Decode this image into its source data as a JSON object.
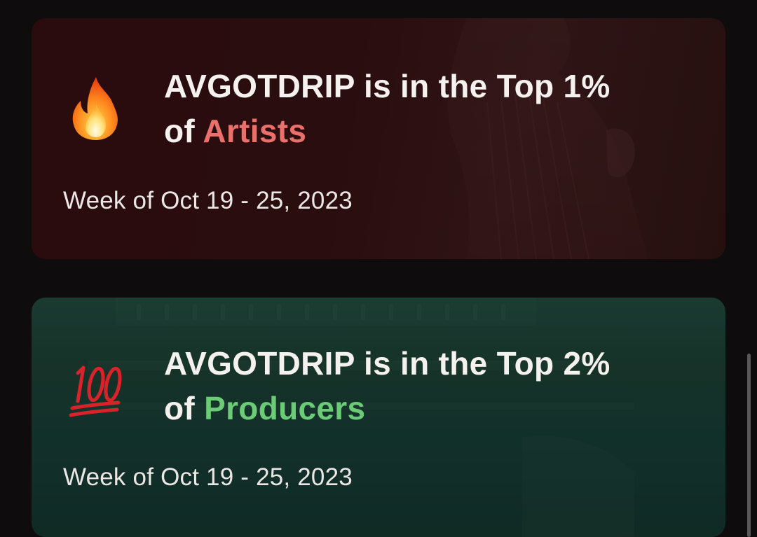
{
  "cards": [
    {
      "id": "artists",
      "icon": "fire-emoji-icon",
      "headline_prefix": "AVGOTDRIP is in the Top 1%",
      "headline_of": "of",
      "highlight": "Artists",
      "highlight_color": "#e9706b",
      "week": "Week of Oct 19 - 25, 2023"
    },
    {
      "id": "producers",
      "icon": "hundred-points-emoji-icon",
      "headline_prefix": "AVGOTDRIP is in the Top 2%",
      "headline_of": "of",
      "highlight": "Producers",
      "highlight_color": "#6ccb76",
      "week": "Week of Oct 19 - 25, 2023"
    }
  ],
  "colors": {
    "background": "#0e0c0c",
    "artists_card": "#2b0c0e",
    "producers_card": "#163229",
    "text": "#f4f1ef"
  }
}
